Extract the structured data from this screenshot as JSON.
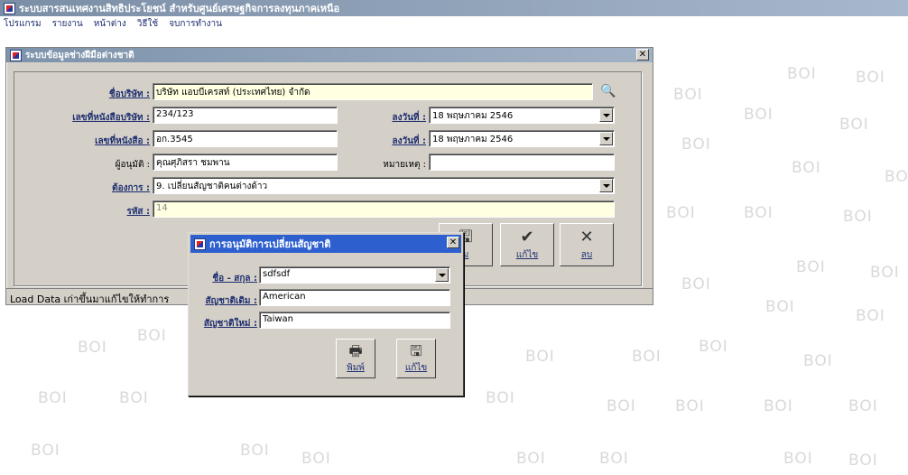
{
  "app": {
    "title": "ระบบสารสนเทศงานสิทธิประโยชน์ สำหรับศูนย์เศรษฐกิจการลงทุนภาคเหนือ",
    "menu": [
      "โปรแกรม",
      "รายงาน",
      "หน้าต่าง",
      "วิธีใช้",
      "จบการทำงาน"
    ]
  },
  "watermark": "BOI",
  "child": {
    "title": "ระบบข้อมูลช่างฝีมือต่างชาติ",
    "close": "✕",
    "company_label": "ชื่อบริษัท :",
    "company_value": "บริษัท แอบบีเครสท์ (ประเทศไทย) จำกัด",
    "cert_no_label": "เลขที่หนังสือบริษัท :",
    "cert_no_value": "234/123",
    "date1_label": "ลงวันที่ :",
    "date1_value": "18 พฤษภาคม  2546",
    "letter_no_label": "เลขที่หนังสือ :",
    "letter_no_value": "อก.3545",
    "date2_label": "ลงวันที่ :",
    "date2_value": "18 พฤษภาคม  2546",
    "approver_label": "ผู้อนุมัติ :",
    "approver_value": "คุณศุภิสรา ชมพาน",
    "remark_label": "หมายเหตุ :",
    "remark_value": "",
    "request_label": "ต้องการ :",
    "request_value": "9. เปลี่ยนสัญชาติคนต่างด้าว",
    "code_label": "รหัส :",
    "code_value": "14",
    "btn_save_label": "ม",
    "btn_edit_label": "แก้ไข",
    "btn_delete_label": "ลบ",
    "status_text": "Load Data เก่าขึ้นมาแก้ไขให้ทำการ"
  },
  "dialog": {
    "title": "การอนุมัติการเปลี่ยนสัญชาติ",
    "close": "✕",
    "name_label": "ชื่อ - สกุล :",
    "name_value": "sdfsdf",
    "old_nat_label": "สัญชาติเดิม :",
    "old_nat_value": "American",
    "new_nat_label": "สัญชาติใหม่ :",
    "new_nat_value": "Taiwan",
    "print_label": "พิมพ์",
    "edit_label": "แก้ไข"
  }
}
